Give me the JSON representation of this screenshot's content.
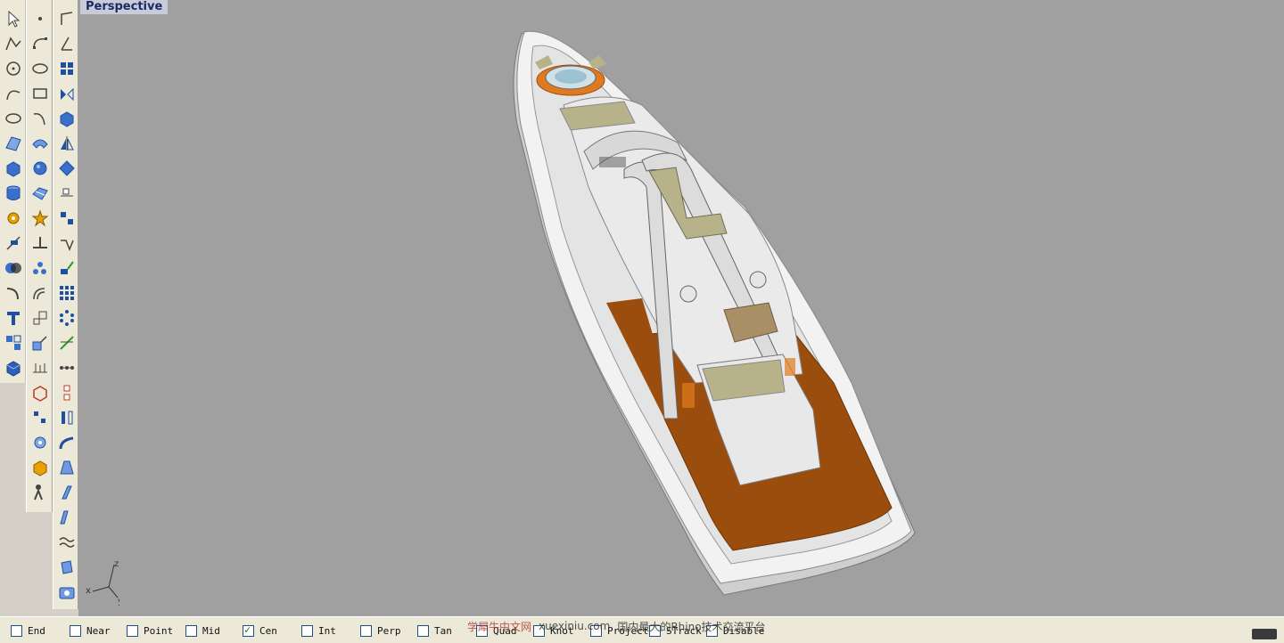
{
  "viewport": {
    "title": "Perspective",
    "background": "#a0a0a0"
  },
  "axes": {
    "x": "x",
    "y": "y",
    "z": "z"
  },
  "toolbars": {
    "left_column_1": [
      "select-arrow-icon",
      "polyline-icon",
      "circle-icon",
      "curve-icon",
      "ellipse-icon",
      "surface-icon",
      "box-icon",
      "cylinder-icon",
      "gear-icon",
      "trim-icon",
      "boolean-icon",
      "fillet-icon",
      "text-icon",
      "group-icon",
      "solid-box-icon"
    ],
    "left_column_2": [
      "point-icon",
      "curve-pt-icon",
      "ellipse-icon",
      "rectangle-icon",
      "arc-icon",
      "sweep-icon",
      "sphere-icon",
      "patch-icon",
      "explode-icon",
      "split-icon",
      "points-icon",
      "offset-icon",
      "scale-icon",
      "move-icon",
      "dimension-icon",
      "bounding-box-icon",
      "array-icon",
      "settings-icon",
      "texture-icon",
      "person-icon"
    ],
    "left_column_3": [
      "polygon-icon",
      "angle-icon",
      "grid-icon",
      "mirror-icon",
      "extrude-icon",
      "symmetry-icon",
      "diamond-icon",
      "snap-icon",
      "rotate-icon",
      "edit-icon",
      "network-icon",
      "array-grid-icon",
      "circular-array-icon",
      "planar-icon",
      "flow-icon",
      "connect-icon",
      "dual-line-icon",
      "blend-icon",
      "taper-icon",
      "twist-icon",
      "bend-icon",
      "wave-icon",
      "contour-icon",
      "capture-icon"
    ]
  },
  "osnap": [
    {
      "label": "End",
      "checked": false
    },
    {
      "label": "Near",
      "checked": false
    },
    {
      "label": "Point",
      "checked": false
    },
    {
      "label": "Mid",
      "checked": false
    },
    {
      "label": "Cen",
      "checked": true
    },
    {
      "label": "Int",
      "checked": false
    },
    {
      "label": "Perp",
      "checked": false
    },
    {
      "label": "Tan",
      "checked": false
    },
    {
      "label": "Quad",
      "checked": false
    },
    {
      "label": "Knot",
      "checked": false
    },
    {
      "label": "Project",
      "checked": false
    },
    {
      "label": "STrack",
      "checked": false
    },
    {
      "label": "Disable",
      "checked": false
    }
  ],
  "watermark": {
    "brand": "学犀牛中文网",
    "site": "xuexiniu.com",
    "slogan": "国内最大的Rhino技术交流平台"
  },
  "colors": {
    "hull": "#f2f2f2",
    "deck": "#9a4d0c",
    "cushion": "#b7b28a",
    "toolbar": "#ece9d8"
  }
}
